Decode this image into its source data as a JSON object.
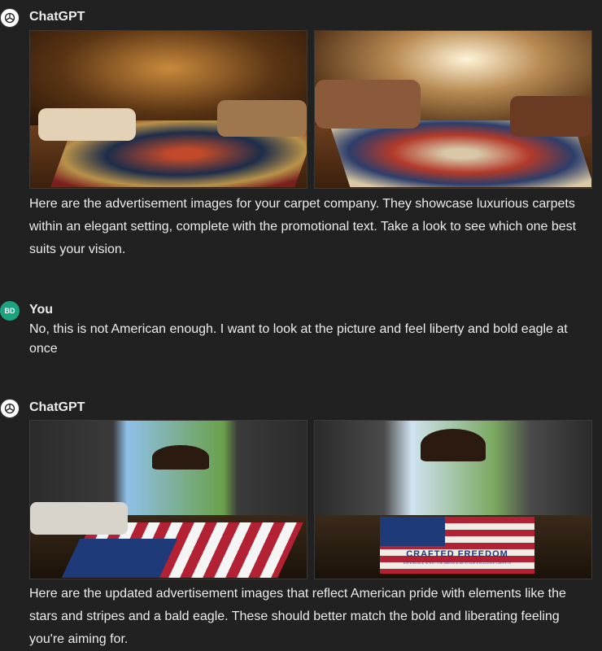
{
  "messages": [
    {
      "author": "ChatGPT",
      "role": "assistant",
      "images": [
        "luxury carpet living room advertisement 1",
        "luxury carpet living room advertisement 2"
      ],
      "text": "Here are the advertisement images for your carpet company. They showcase luxurious carpets within an elegant setting, complete with the promotional text. Take a look to see which one best suits your vision."
    },
    {
      "author": "You",
      "role": "user",
      "avatar_initials": "BD",
      "text": "No, this is not American enough. I want to look at the picture and feel liberty and bold eagle at once"
    },
    {
      "author": "ChatGPT",
      "role": "assistant",
      "images": [
        "american flag carpet with bald eagle advertisement 1",
        "american flag carpet with bald eagle advertisement 2"
      ],
      "image_texts": {
        "rug_title": "CRAFTED FREEDOM",
        "rug_subtitle": "EXPERIENCE SPIRIT THE AMERICA WITH OUR EXCLUSIVE CARPETS"
      },
      "text": "Here are the updated advertisement images that reflect American pride with elements like the stars and stripes and a bald eagle. These should better match the bold and liberating feeling you're aiming for."
    }
  ],
  "colors": {
    "background": "#212121",
    "text": "#ececec",
    "user_avatar": "#19a37f"
  },
  "icons": {
    "assistant_avatar": "openai-logo-icon"
  }
}
